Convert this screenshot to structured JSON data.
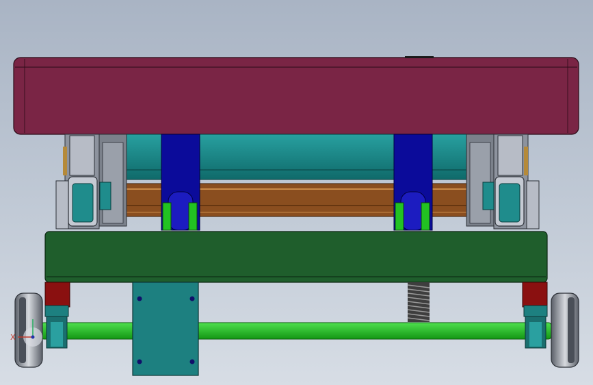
{
  "axis_indicator": {
    "x_label": "X"
  },
  "colors": {
    "background_top": "#a9b4c4",
    "background_bottom": "#d7dde5",
    "table_top": "#7a2545",
    "base_frame": "#1f5e2c",
    "hydraulic_cylinder": "#1a7f7f",
    "scissor_arm_blue": "#0b0b9a",
    "wooden_beam": "#8a4e1f",
    "green_axle": "#22b422",
    "bearing_block_red": "#8a1010",
    "caster_plate": "#1d8080",
    "wheel": "#8a8f99",
    "spring": "#4a4a4a"
  }
}
